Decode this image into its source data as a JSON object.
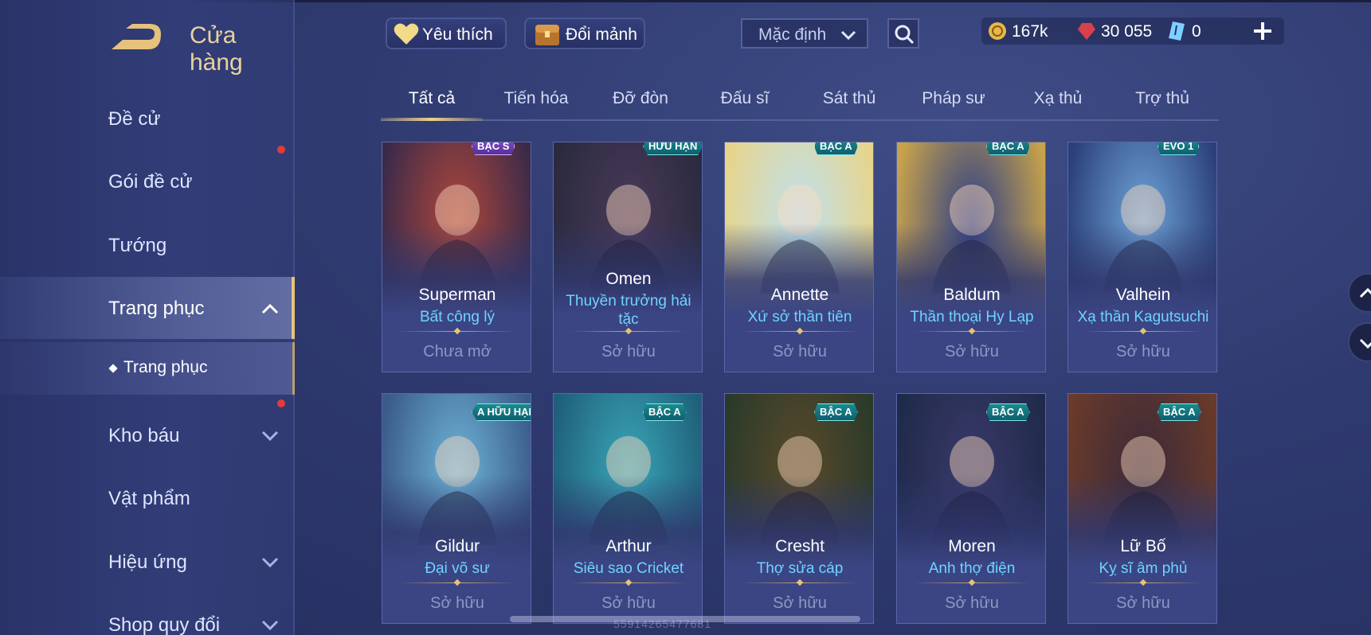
{
  "header": {
    "title": "Cửa hàng",
    "favorite_label": "Yêu thích",
    "exchange_label": "Đổi mảnh",
    "sort": {
      "selected": "Mặc định"
    },
    "currency": [
      {
        "icon": "coin-icon",
        "value": "167k"
      },
      {
        "icon": "ruby-icon",
        "value": "30 055"
      },
      {
        "icon": "voucher-icon",
        "value": "0"
      }
    ]
  },
  "sidebar": {
    "items": [
      {
        "label": "Đề cử"
      },
      {
        "label": "Gói đề cử"
      },
      {
        "label": "Tướng"
      },
      {
        "label": "Trang phục"
      },
      {
        "label": "Kho báu"
      },
      {
        "label": "Vật phẩm"
      },
      {
        "label": "Hiệu ứng"
      },
      {
        "label": "Shop quy đổi"
      }
    ],
    "subitem": {
      "label": "Trang phục"
    }
  },
  "tabs": [
    "Tất cả",
    "Tiến hóa",
    "Đỡ đòn",
    "Đấu sĩ",
    "Sát thủ",
    "Pháp sư",
    "Xạ thủ",
    "Trợ thủ"
  ],
  "cards": [
    {
      "hero": "Superman",
      "skin": "Bất công lý",
      "status": "Chưa mở",
      "badge": "BẬC S",
      "badge_color": "#7a4cc4"
    },
    {
      "hero": "Omen",
      "skin": "Thuyền trưởng hải tặc",
      "status": "Sở hữu",
      "badge": "HỮU HẠN",
      "badge_color": "#1a8b8e"
    },
    {
      "hero": "Annette",
      "skin": "Xứ sở thần tiên",
      "status": "Sở hữu",
      "badge": "BẬC A",
      "badge_color": "#1a8b8e"
    },
    {
      "hero": "Baldum",
      "skin": "Thần thoại Hy Lạp",
      "status": "Sở hữu",
      "badge": "BẬC A",
      "badge_color": "#1a8b8e"
    },
    {
      "hero": "Valhein",
      "skin": "Xạ thần Kagutsuchi",
      "status": "Sở hữu",
      "badge": "EVO 1",
      "badge_color": "#3a6bd6"
    },
    {
      "hero": "Gildur",
      "skin": "Đại võ sư",
      "status": "Sở hữu",
      "badge": "A HỮU HẠN",
      "badge_color": "#1a8b8e"
    },
    {
      "hero": "Arthur",
      "skin": "Siêu sao Cricket",
      "status": "Sở hữu",
      "badge": "BẬC A",
      "badge_color": "#1a8b8e"
    },
    {
      "hero": "Cresht",
      "skin": "Thợ sửa cáp",
      "status": "Sở hữu",
      "badge": "BẬC A",
      "badge_color": "#1a8b8e"
    },
    {
      "hero": "Moren",
      "skin": "Anh thợ điện",
      "status": "Sở hữu",
      "badge": "BẬC A",
      "badge_color": "#1a8b8e"
    },
    {
      "hero": "Lữ Bố",
      "skin": "Kỵ sĩ âm phủ",
      "status": "Sở hữu",
      "badge": "BẬC A",
      "badge_color": "#1a8b8e"
    }
  ],
  "watermark": "55914265477681"
}
